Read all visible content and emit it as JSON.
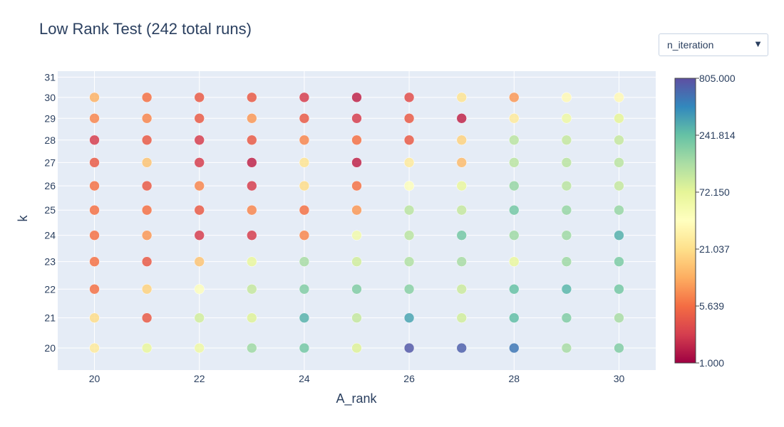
{
  "title": "Low Rank Test (242 total runs)",
  "dropdown": {
    "selected": "n_iteration"
  },
  "colors": {
    "plot_bg": "#e5ecf6",
    "grid": "#ffffff",
    "text": "#2a3f5f"
  },
  "chart_data": {
    "type": "scatter",
    "title": "Low Rank Test (242 total runs)",
    "xlabel": "A_rank",
    "ylabel": "k",
    "x_ticks": [
      20,
      22,
      24,
      26,
      28,
      30
    ],
    "y_ticks": [
      20,
      21,
      22,
      23,
      24,
      25,
      26,
      27,
      28,
      29,
      30,
      31
    ],
    "y_scale": "log",
    "grid": true,
    "colorscale": "Spectral",
    "color_scale_type": "log",
    "color_ticks": [
      "805.000",
      "241.814",
      "72.150",
      "21.037",
      "5.639",
      "1.000"
    ],
    "color_range": [
      1,
      805
    ],
    "colorbar_position": "right",
    "x": [
      20,
      21,
      22,
      23,
      24,
      25,
      26,
      27,
      28,
      29,
      30
    ],
    "y": [
      20,
      21,
      22,
      23,
      24,
      25,
      26,
      27,
      28,
      29,
      30
    ],
    "values": [
      [
        18,
        8,
        2,
        3,
        16,
        14
      ],
      [
        14,
        3,
        9,
        3,
        14,
        3
      ],
      [
        40,
        12,
        3,
        3,
        3,
        3
      ],
      [
        80,
        22,
        2,
        4,
        5,
        3
      ],
      [
        250,
        45,
        2,
        14,
        3,
        3
      ],
      [
        45,
        45,
        2,
        3,
        2,
        3
      ],
      [
        700,
        180,
        3,
        18,
        3,
        3
      ],
      [
        700,
        80,
        8,
        4,
        3,
        8
      ],
      [
        500,
        100,
        3,
        8,
        4,
        3
      ],
      [
        90,
        120,
        150,
        4,
        4,
        4
      ],
      [
        120,
        80,
        120,
        5,
        5,
        3
      ],
      [
        26,
        2,
        40,
        3,
        3,
        12,
        3
      ],
      [
        4,
        8,
        140,
        3,
        3,
        12,
        2
      ],
      [
        4,
        4,
        5,
        5,
        5,
        4,
        3
      ],
      [
        120,
        120,
        30,
        30,
        50,
        22,
        14
      ],
      [
        80,
        200,
        35,
        22,
        3,
        2,
        2
      ],
      [
        80,
        120,
        80,
        90,
        120,
        30,
        35
      ],
      [
        120,
        60,
        120,
        100,
        10,
        18,
        70
      ],
      [
        80,
        100,
        20,
        40,
        100,
        120,
        80
      ],
      [
        250,
        150,
        60,
        100,
        5,
        2,
        1
      ],
      [
        200,
        130,
        150,
        75,
        20,
        15,
        35
      ]
    ],
    "points": [
      {
        "x": 20,
        "y": 20,
        "value": 18
      },
      {
        "x": 20,
        "y": 21,
        "value": 14
      },
      {
        "x": 20,
        "y": 22,
        "value": 4
      },
      {
        "x": 20,
        "y": 23,
        "value": 4
      },
      {
        "x": 20,
        "y": 24,
        "value": 4
      },
      {
        "x": 20,
        "y": 25,
        "value": 4
      },
      {
        "x": 20,
        "y": 26,
        "value": 4
      },
      {
        "x": 20,
        "y": 27,
        "value": 3
      },
      {
        "x": 20,
        "y": 28,
        "value": 2
      },
      {
        "x": 20,
        "y": 29,
        "value": 5
      },
      {
        "x": 20,
        "y": 30,
        "value": 8
      },
      {
        "x": 21,
        "y": 20,
        "value": 50
      },
      {
        "x": 21,
        "y": 21,
        "value": 3
      },
      {
        "x": 21,
        "y": 22,
        "value": 12
      },
      {
        "x": 21,
        "y": 23,
        "value": 3
      },
      {
        "x": 21,
        "y": 24,
        "value": 6
      },
      {
        "x": 21,
        "y": 25,
        "value": 4
      },
      {
        "x": 21,
        "y": 26,
        "value": 3
      },
      {
        "x": 21,
        "y": 27,
        "value": 10
      },
      {
        "x": 21,
        "y": 28,
        "value": 3
      },
      {
        "x": 21,
        "y": 29,
        "value": 5
      },
      {
        "x": 21,
        "y": 30,
        "value": 4
      },
      {
        "x": 22,
        "y": 20,
        "value": 45
      },
      {
        "x": 22,
        "y": 21,
        "value": 70
      },
      {
        "x": 22,
        "y": 22,
        "value": 30
      },
      {
        "x": 22,
        "y": 23,
        "value": 10
      },
      {
        "x": 22,
        "y": 24,
        "value": 2
      },
      {
        "x": 22,
        "y": 25,
        "value": 3
      },
      {
        "x": 22,
        "y": 26,
        "value": 5
      },
      {
        "x": 22,
        "y": 27,
        "value": 2
      },
      {
        "x": 22,
        "y": 28,
        "value": 2
      },
      {
        "x": 22,
        "y": 29,
        "value": 3
      },
      {
        "x": 22,
        "y": 30,
        "value": 3
      },
      {
        "x": 23,
        "y": 20,
        "value": 120
      },
      {
        "x": 23,
        "y": 21,
        "value": 60
      },
      {
        "x": 23,
        "y": 22,
        "value": 80
      },
      {
        "x": 23,
        "y": 23,
        "value": 50
      },
      {
        "x": 23,
        "y": 24,
        "value": 2
      },
      {
        "x": 23,
        "y": 25,
        "value": 5
      },
      {
        "x": 23,
        "y": 26,
        "value": 2
      },
      {
        "x": 23,
        "y": 27,
        "value": 1.5
      },
      {
        "x": 23,
        "y": 28,
        "value": 3
      },
      {
        "x": 23,
        "y": 29,
        "value": 6
      },
      {
        "x": 23,
        "y": 30,
        "value": 3
      },
      {
        "x": 24,
        "y": 20,
        "value": 180
      },
      {
        "x": 24,
        "y": 21,
        "value": 250
      },
      {
        "x": 24,
        "y": 22,
        "value": 160
      },
      {
        "x": 24,
        "y": 23,
        "value": 110
      },
      {
        "x": 24,
        "y": 24,
        "value": 5
      },
      {
        "x": 24,
        "y": 25,
        "value": 4
      },
      {
        "x": 24,
        "y": 26,
        "value": 14
      },
      {
        "x": 24,
        "y": 27,
        "value": 16
      },
      {
        "x": 24,
        "y": 28,
        "value": 5
      },
      {
        "x": 24,
        "y": 29,
        "value": 3
      },
      {
        "x": 24,
        "y": 30,
        "value": 2
      },
      {
        "x": 25,
        "y": 20,
        "value": 60
      },
      {
        "x": 25,
        "y": 21,
        "value": 80
      },
      {
        "x": 25,
        "y": 22,
        "value": 160
      },
      {
        "x": 25,
        "y": 23,
        "value": 70
      },
      {
        "x": 25,
        "y": 24,
        "value": 40
      },
      {
        "x": 25,
        "y": 25,
        "value": 6
      },
      {
        "x": 25,
        "y": 26,
        "value": 4
      },
      {
        "x": 25,
        "y": 27,
        "value": 1.5
      },
      {
        "x": 25,
        "y": 28,
        "value": 4
      },
      {
        "x": 25,
        "y": 29,
        "value": 2
      },
      {
        "x": 25,
        "y": 30,
        "value": 1.5
      },
      {
        "x": 26,
        "y": 20,
        "value": 700
      },
      {
        "x": 26,
        "y": 21,
        "value": 300
      },
      {
        "x": 26,
        "y": 22,
        "value": 150
      },
      {
        "x": 26,
        "y": 23,
        "value": 100
      },
      {
        "x": 26,
        "y": 24,
        "value": 90
      },
      {
        "x": 26,
        "y": 25,
        "value": 90
      },
      {
        "x": 26,
        "y": 26,
        "value": 30
      },
      {
        "x": 26,
        "y": 27,
        "value": 18
      },
      {
        "x": 26,
        "y": 28,
        "value": 3
      },
      {
        "x": 26,
        "y": 29,
        "value": 3
      },
      {
        "x": 26,
        "y": 30,
        "value": 2.5
      },
      {
        "x": 27,
        "y": 20,
        "value": 650
      },
      {
        "x": 27,
        "y": 21,
        "value": 70
      },
      {
        "x": 27,
        "y": 22,
        "value": 75
      },
      {
        "x": 27,
        "y": 23,
        "value": 110
      },
      {
        "x": 27,
        "y": 24,
        "value": 180
      },
      {
        "x": 27,
        "y": 25,
        "value": 80
      },
      {
        "x": 27,
        "y": 26,
        "value": 50
      },
      {
        "x": 27,
        "y": 27,
        "value": 9
      },
      {
        "x": 27,
        "y": 28,
        "value": 12
      },
      {
        "x": 27,
        "y": 29,
        "value": 1.5
      },
      {
        "x": 27,
        "y": 30,
        "value": 16
      },
      {
        "x": 28,
        "y": 20,
        "value": 500
      },
      {
        "x": 28,
        "y": 21,
        "value": 220
      },
      {
        "x": 28,
        "y": 22,
        "value": 210
      },
      {
        "x": 28,
        "y": 23,
        "value": 50
      },
      {
        "x": 28,
        "y": 24,
        "value": 120
      },
      {
        "x": 28,
        "y": 25,
        "value": 180
      },
      {
        "x": 28,
        "y": 26,
        "value": 130
      },
      {
        "x": 28,
        "y": 27,
        "value": 90
      },
      {
        "x": 28,
        "y": 28,
        "value": 90
      },
      {
        "x": 28,
        "y": 29,
        "value": 18
      },
      {
        "x": 28,
        "y": 30,
        "value": 6
      },
      {
        "x": 29,
        "y": 20,
        "value": 110
      },
      {
        "x": 29,
        "y": 21,
        "value": 160
      },
      {
        "x": 29,
        "y": 22,
        "value": 240
      },
      {
        "x": 29,
        "y": 23,
        "value": 120
      },
      {
        "x": 29,
        "y": 24,
        "value": 120
      },
      {
        "x": 29,
        "y": 25,
        "value": 130
      },
      {
        "x": 29,
        "y": 26,
        "value": 90
      },
      {
        "x": 29,
        "y": 27,
        "value": 90
      },
      {
        "x": 29,
        "y": 28,
        "value": 80
      },
      {
        "x": 29,
        "y": 29,
        "value": 45
      },
      {
        "x": 29,
        "y": 30,
        "value": 25
      },
      {
        "x": 30,
        "y": 20,
        "value": 160
      },
      {
        "x": 30,
        "y": 21,
        "value": 110
      },
      {
        "x": 30,
        "y": 22,
        "value": 180
      },
      {
        "x": 30,
        "y": 23,
        "value": 170
      },
      {
        "x": 30,
        "y": 24,
        "value": 260
      },
      {
        "x": 30,
        "y": 25,
        "value": 130
      },
      {
        "x": 30,
        "y": 26,
        "value": 80
      },
      {
        "x": 30,
        "y": 27,
        "value": 90
      },
      {
        "x": 30,
        "y": 28,
        "value": 80
      },
      {
        "x": 30,
        "y": 29,
        "value": 55
      },
      {
        "x": 30,
        "y": 30,
        "value": 25
      }
    ]
  }
}
